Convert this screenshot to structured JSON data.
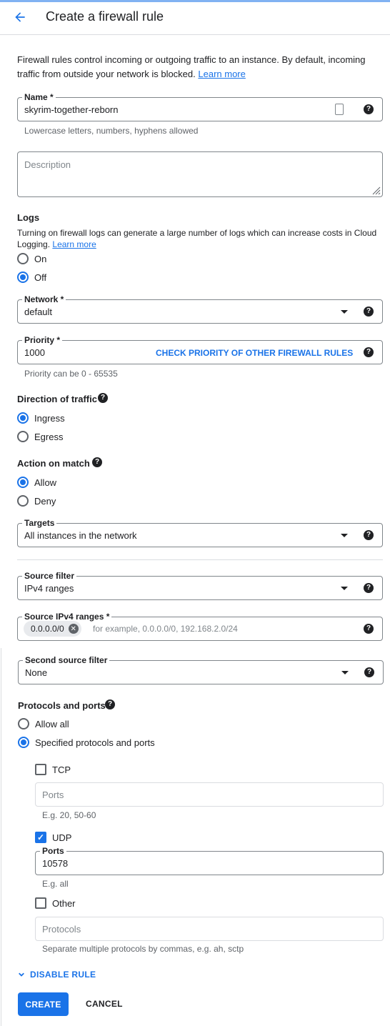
{
  "header": {
    "title": "Create a firewall rule",
    "back_icon": "arrow-back-icon"
  },
  "intro": {
    "text": "Firewall rules control incoming or outgoing traffic to an instance. By default, incoming traffic from outside your network is blocked.",
    "link": "Learn more"
  },
  "name": {
    "label": "Name *",
    "value": "skyrim-together-reborn",
    "hint": "Lowercase letters, numbers, hyphens allowed"
  },
  "description": {
    "placeholder": "Description"
  },
  "logs": {
    "title": "Logs",
    "text": "Turning on firewall logs can generate a large number of logs which can increase costs in Cloud Logging.",
    "link": "Learn more",
    "options": [
      "On",
      "Off"
    ],
    "selected": "Off"
  },
  "network": {
    "label": "Network *",
    "value": "default"
  },
  "priority": {
    "label": "Priority *",
    "value": "1000",
    "action": "CHECK PRIORITY OF OTHER FIREWALL RULES",
    "hint": "Priority can be 0 - 65535"
  },
  "direction": {
    "title": "Direction of traffic",
    "options": [
      "Ingress",
      "Egress"
    ],
    "selected": "Ingress"
  },
  "action": {
    "title": "Action on match",
    "options": [
      "Allow",
      "Deny"
    ],
    "selected": "Allow"
  },
  "targets": {
    "label": "Targets",
    "value": "All instances in the network"
  },
  "source_filter": {
    "label": "Source filter",
    "value": "IPv4 ranges"
  },
  "source_ranges": {
    "label": "Source IPv4 ranges *",
    "chip": "0.0.0.0/0",
    "placeholder": "for example, 0.0.0.0/0, 192.168.2.0/24"
  },
  "second_source": {
    "label": "Second source filter",
    "value": "None"
  },
  "protocols": {
    "title": "Protocols and ports",
    "options": [
      "Allow all",
      "Specified protocols and ports"
    ],
    "selected": "Specified protocols and ports",
    "tcp": {
      "label": "TCP",
      "checked": false,
      "placeholder": "Ports",
      "hint": "E.g. 20, 50-60"
    },
    "udp": {
      "label": "UDP",
      "checked": true,
      "field_label": "Ports",
      "value": "10578",
      "hint": "E.g. all"
    },
    "other": {
      "label": "Other",
      "checked": false,
      "placeholder": "Protocols",
      "hint": "Separate multiple protocols by commas, e.g. ah, sctp"
    }
  },
  "disable_rule": "DISABLE RULE",
  "buttons": {
    "create": "CREATE",
    "cancel": "CANCEL"
  },
  "colors": {
    "accent": "#1a73e8",
    "text": "#202124",
    "muted": "#5f6368",
    "border": "#dadce0"
  },
  "help_symbol": "?",
  "check_symbol": "✓",
  "close_symbol": "✕"
}
